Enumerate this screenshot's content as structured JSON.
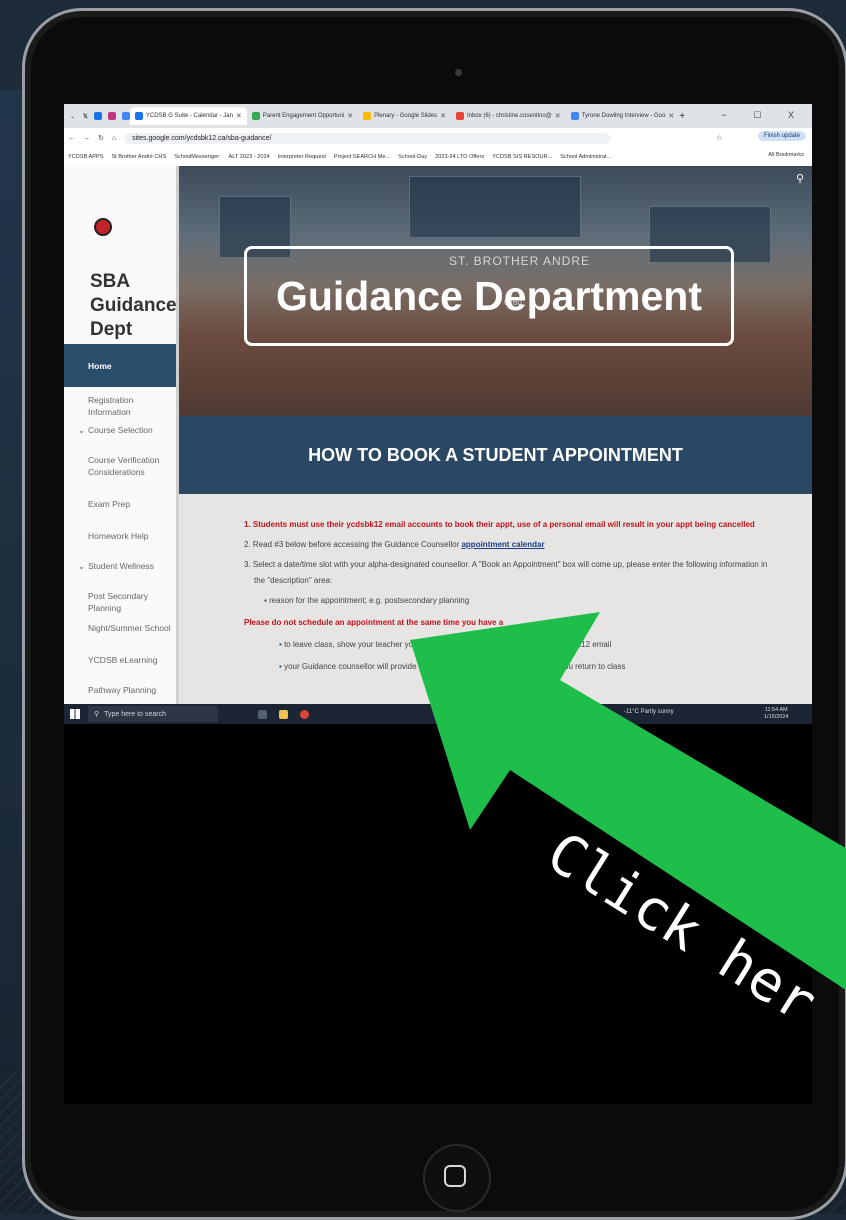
{
  "browser": {
    "tabs": [
      {
        "label": "YCDSB G Suite - Calendar - Jan",
        "color": "#1a73e8"
      },
      {
        "label": "Parent Engagement Opportuni",
        "color": "#34a853"
      },
      {
        "label": "Plenary - Google Slides",
        "color": "#fbbc04"
      },
      {
        "label": "Inbox (6) - christine.cosentino@",
        "color": "#ea4335"
      },
      {
        "label": "Tyrone Dowling Interview - Goo",
        "color": "#4285f4"
      }
    ],
    "window_controls": "− ☐ X",
    "url": "sites.google.com/ycdsbk12.ca/sba-guidance/",
    "finish_update": "Finish update",
    "bookmarks": [
      "YCDSB APPS",
      "St Brother André CHS",
      "SchoolMessenger:",
      "ALT 2023 - 2024",
      "Interpreter Request",
      "Project SEARCH Me...",
      "School-Day",
      "2023-24 LTO Offers",
      "YCDSB SIS RESOUR...",
      "School Administrat..."
    ],
    "all_bookmarks": "All Bookmarks"
  },
  "site": {
    "title": "SBA Guidance Dept",
    "nav": [
      {
        "label": "Home"
      },
      {
        "label": "Registration Information"
      },
      {
        "label": "Course Selection",
        "expandable": true
      },
      {
        "label": "Course Verification Considerations"
      },
      {
        "label": "Exam Prep"
      },
      {
        "label": "Homework Help"
      },
      {
        "label": "Student Wellness",
        "expandable": true
      },
      {
        "label": "Post Secondary Planning"
      },
      {
        "label": "Night/Summer School"
      },
      {
        "label": "YCDSB eLearning"
      },
      {
        "label": "Pathway Planning"
      }
    ],
    "hero": {
      "title": "Guidance Department",
      "sign": "ST. BROTHER ANDRE",
      "sign_number": "6160"
    },
    "section_heading": "HOW TO BOOK A STUDENT APPOINTMENT",
    "steps": {
      "step1": "1. Students must use their ycdsbk12 email accounts to book their appt, use of a personal email will result in your appt being cancelled",
      "step2_prefix": "2. Read #3 below before accessing the Guidance Counsellor ",
      "step2_link": "appointment calendar",
      "step3_line1": "3. Select a date/time slot with your alpha-designated counsellor. A \"Book an Appointment\" box will come up, please enter the following information in",
      "step3_line2": "the \"description\" area:",
      "bullet_reason": "reason for the appointment; e.g. postsecondary planning",
      "warning": "Please do not schedule an appointment at the same time you have a",
      "bullet_leave_a": "to leave class, show your teacher your s",
      "bullet_leave_b": "dar or k12 email",
      "bullet_counsellor_a": "your Guidance counsellor will provide yo",
      "bullet_counsellor_b": "ou return to class"
    }
  },
  "taskbar": {
    "search_placeholder": "Type here to search",
    "weather": "-11°C  Partly sunny",
    "time": "11:54 AM",
    "date": "1/15/2024"
  },
  "overlay": {
    "callout": "Click her",
    "arrow_color": "#1fbe4a"
  }
}
